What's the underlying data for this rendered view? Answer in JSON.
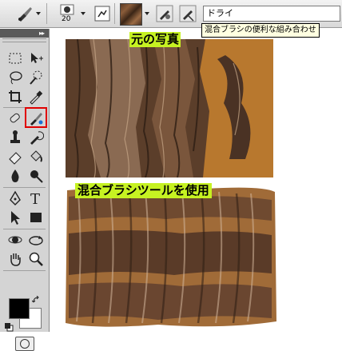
{
  "options_bar": {
    "brush_size": "20",
    "preset_value": "ドライ",
    "tooltip": "混合ブラシの便利な組み合わせ",
    "icons": [
      "mixer-brush-icon",
      "brush-preset-icon",
      "brush-panel-icon",
      "swatch-icon",
      "load-brush-icon",
      "clean-brush-icon"
    ]
  },
  "tools_panel": {
    "collapse_glyph": "▸▸",
    "selected_tool": "mixer-brush-tool",
    "foreground_color": "#000000",
    "background_color": "#ffffff",
    "highlight_color": "#e00000"
  },
  "images": {
    "original_label": "元の写真",
    "result_label": "混合ブラシツールを使用",
    "label_color": "#c6f222"
  }
}
